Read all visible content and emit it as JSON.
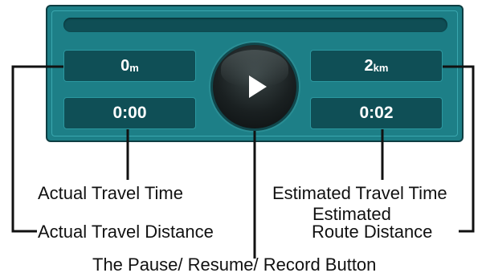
{
  "display": {
    "distance_left": {
      "value": "0",
      "unit": "m"
    },
    "time_left": "0:00",
    "distance_right": {
      "value": "2",
      "unit": "km"
    },
    "time_right": "0:02",
    "button_icon": "play-icon"
  },
  "labels": {
    "actual_travel_time": "Actual Travel Time",
    "actual_travel_distance": "Actual Travel Distance",
    "estimated_travel_time": "Estimated Travel Time",
    "estimated_route_distance_line1": "Estimated",
    "estimated_route_distance_line2": "Route Distance",
    "pause_resume_record_button": "The Pause/ Resume/ Record Button"
  },
  "colors": {
    "panel": "#1d7f87",
    "box": "#0f4f56",
    "text": "#ffffff",
    "callout": "#111111"
  }
}
